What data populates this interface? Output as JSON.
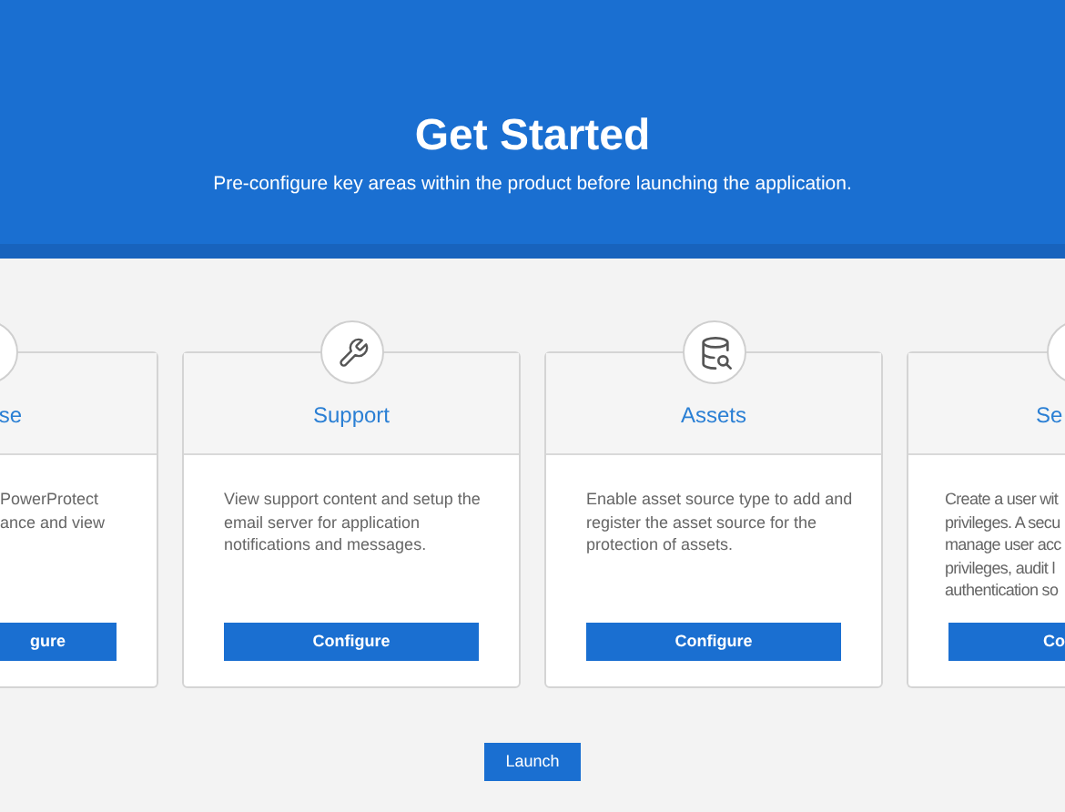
{
  "header": {
    "title": "Get Started",
    "subtitle": "Pre-configure key areas within the product before launching the application."
  },
  "cards": [
    {
      "kind": "left-cut",
      "title": "se",
      "description_lines": [
        "PowerProtect",
        "ance and view"
      ],
      "button": "gure"
    },
    {
      "kind": "full",
      "title": "Support",
      "description_lines": [
        "View support content and setup the",
        "email server for application",
        "notifications and messages."
      ],
      "button": "Configure"
    },
    {
      "kind": "full",
      "title": "Assets",
      "description_lines": [
        "Enable asset source type to add and",
        "register the asset source for the",
        "protection of assets."
      ],
      "button": "Configure"
    },
    {
      "kind": "right-cut",
      "title": "Se",
      "description_lines": [
        "Create a user wit",
        "privileges. A secu",
        "manage user acc",
        "privileges, audit l",
        "authentication so"
      ],
      "button": "Co"
    }
  ],
  "launch_button": "Launch"
}
